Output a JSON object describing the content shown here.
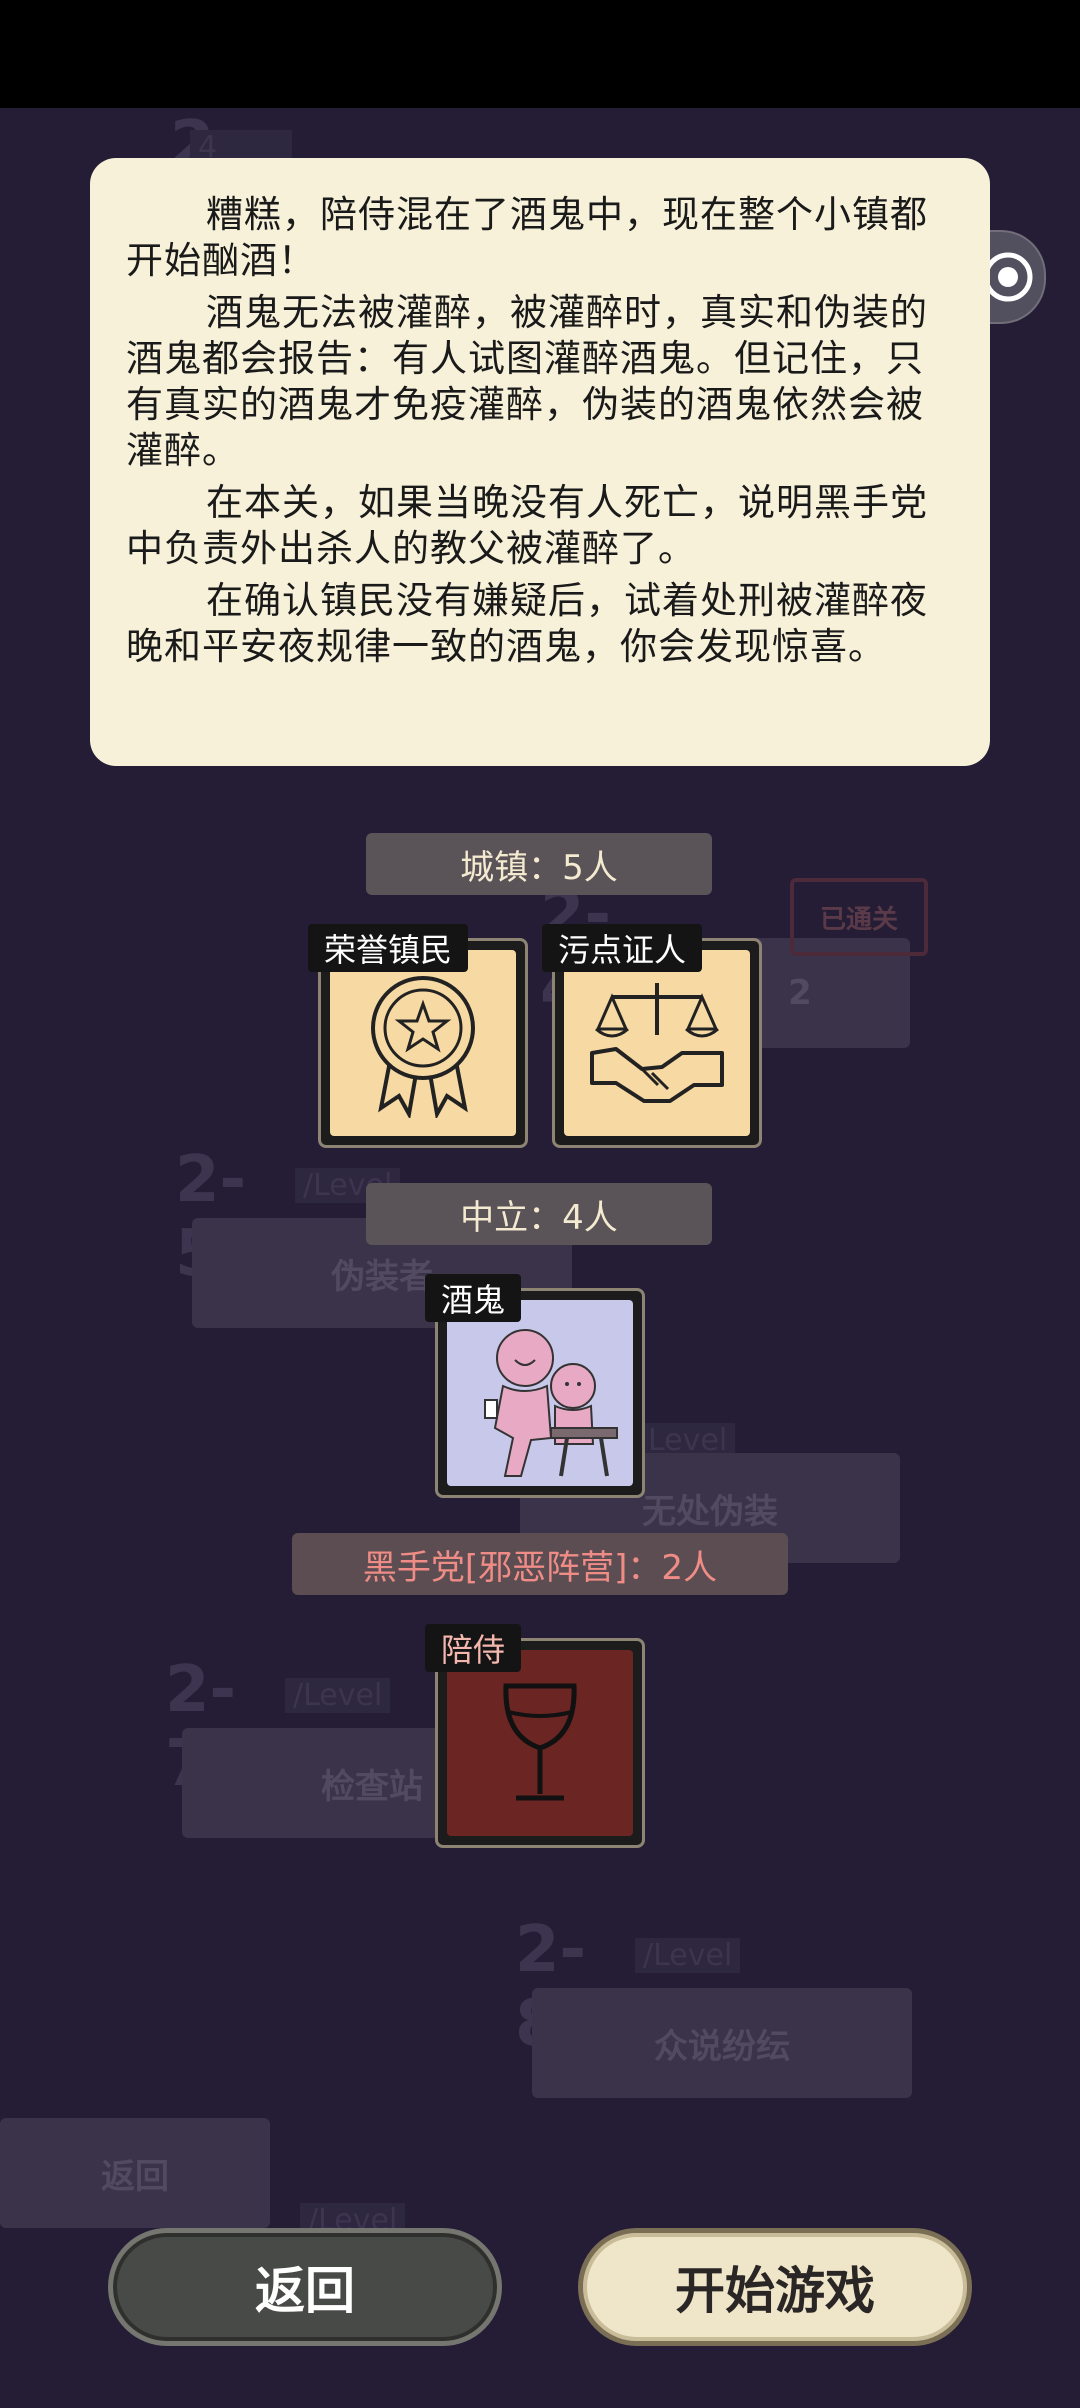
{
  "intro": {
    "paragraphs": [
      "糟糕，陪侍混在了酒鬼中，现在整个小镇都开始酗酒！",
      "酒鬼无法被灌醉，被灌醉时，真实和伪装的酒鬼都会报告：有人试图灌醉酒鬼。但记住，只有真实的酒鬼才免疫灌醉，伪装的酒鬼依然会被灌醉。",
      "在本关，如果当晚没有人死亡，说明黑手党中负责外出杀人的教父被灌醉了。",
      "在确认镇民没有嫌疑后，试着处刑被灌醉夜晚和平安夜规律一致的酒鬼，你会发现惊喜。"
    ]
  },
  "factions": [
    {
      "header": "城镇：5人",
      "roles": [
        "荣誉镇民",
        "污点证人"
      ]
    },
    {
      "header": "中立：4人",
      "roles": [
        "酒鬼"
      ]
    },
    {
      "header": "黑手党[邪恶阵营]：2人",
      "roles": [
        "陪侍"
      ]
    }
  ],
  "buttons": {
    "back": "返回",
    "start": "开始游戏"
  },
  "background_levels": [
    {
      "num": "2-1",
      "tag": "4 10/10"
    },
    {
      "num": "2-4",
      "tag": "/Level",
      "name": "2",
      "stamp": "已通关"
    },
    {
      "num": "2-5",
      "tag": "/Level",
      "name": "伪装者"
    },
    {
      "num": "",
      "tag": "Level",
      "name": "无处伪装"
    },
    {
      "num": "2-7",
      "tag": "/Level",
      "name": "检查站"
    },
    {
      "num": "2-8",
      "tag": "/Level",
      "name": "众说纷纭"
    },
    {
      "num": "",
      "tag": "/Level",
      "name": "返回"
    }
  ],
  "icons": {
    "menu": "more-dots-icon",
    "close": "target-circle-icon",
    "honor_citizen": "medal-icon",
    "witness": "scales-handshake-icon",
    "drunk": "drinking-people-icon",
    "escort": "wine-glass-icon"
  },
  "colors": {
    "town_card": "#f7d9a3",
    "neutral_card": "#c8c9ea",
    "evil_card": "#6b2523"
  }
}
